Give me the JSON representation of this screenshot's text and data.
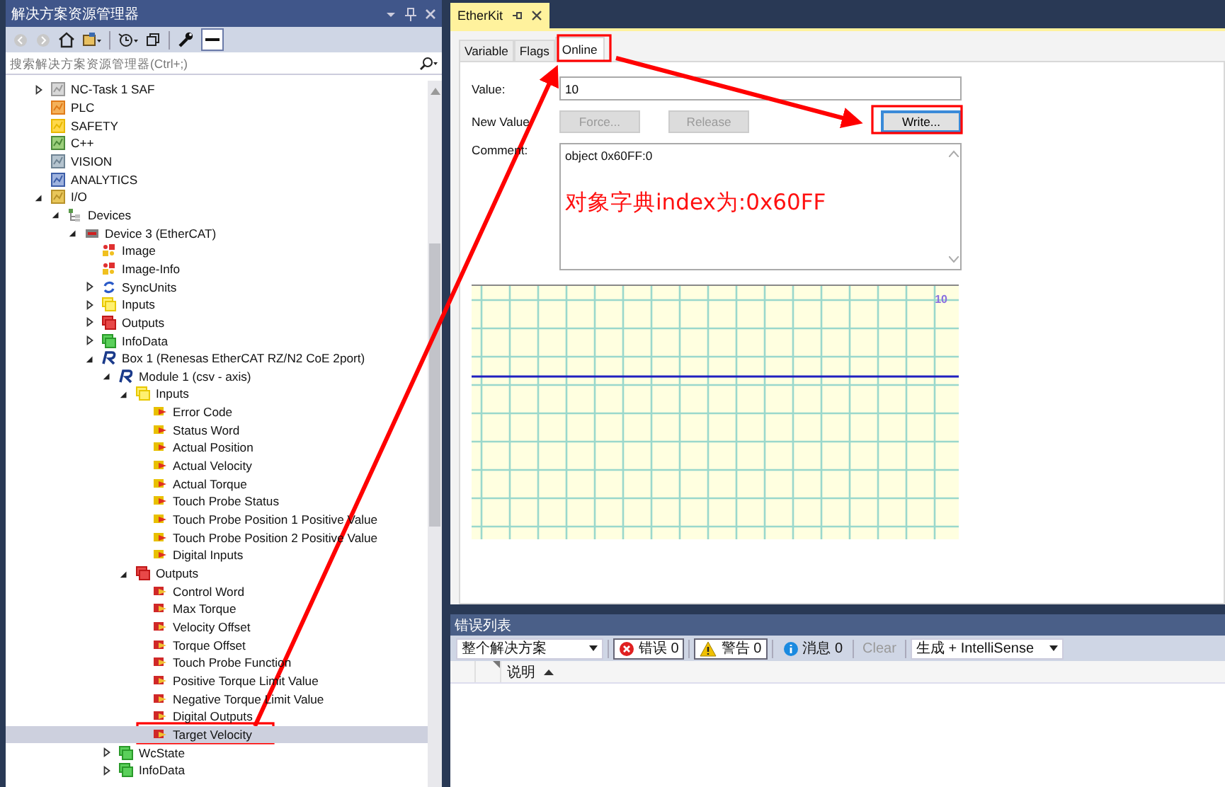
{
  "solution_explorer": {
    "title": "解决方案资源管理器",
    "search": {
      "placeholder": "搜索解决方案资源管理器(Ctrl+;)"
    },
    "tree": [
      {
        "label": "NC-Task 1 SAF",
        "kind": "task",
        "expanded": false,
        "selected": false
      },
      {
        "label": "PLC",
        "kind": "plc",
        "selected": false
      },
      {
        "label": "SAFETY",
        "kind": "safety",
        "selected": false
      },
      {
        "label": "C++",
        "kind": "cpp",
        "selected": false
      },
      {
        "label": "VISION",
        "kind": "vision",
        "selected": false
      },
      {
        "label": "ANALYTICS",
        "kind": "analytics",
        "selected": false
      },
      {
        "label": "I/O",
        "kind": "io",
        "expanded": true,
        "selected": false,
        "children": [
          {
            "label": "Devices",
            "kind": "devices",
            "expanded": true,
            "selected": false,
            "children": [
              {
                "label": "Device 3 (EtherCAT)",
                "kind": "device",
                "expanded": true,
                "selected": false,
                "children": [
                  {
                    "label": "Image",
                    "kind": "image",
                    "selected": false
                  },
                  {
                    "label": "Image-Info",
                    "kind": "image",
                    "selected": false
                  },
                  {
                    "label": "SyncUnits",
                    "kind": "sync",
                    "expanded": false,
                    "selected": false
                  },
                  {
                    "label": "Inputs",
                    "kind": "inputs",
                    "expanded": false,
                    "selected": false
                  },
                  {
                    "label": "Outputs",
                    "kind": "outputs",
                    "expanded": false,
                    "selected": false
                  },
                  {
                    "label": "InfoData",
                    "kind": "infodata",
                    "expanded": false,
                    "selected": false
                  },
                  {
                    "label": "Box 1 (Renesas EtherCAT RZ/N2 CoE 2port)",
                    "kind": "box",
                    "expanded": true,
                    "selected": false,
                    "children": [
                      {
                        "label": "Module 1 (csv - axis)",
                        "kind": "box",
                        "expanded": true,
                        "selected": false,
                        "children": [
                          {
                            "label": "Inputs",
                            "kind": "inputs",
                            "expanded": true,
                            "selected": false,
                            "children": [
                              {
                                "label": "Error Code",
                                "kind": "input-var",
                                "selected": false
                              },
                              {
                                "label": "Status Word",
                                "kind": "input-var",
                                "selected": false
                              },
                              {
                                "label": "Actual Position",
                                "kind": "input-var",
                                "selected": false
                              },
                              {
                                "label": "Actual Velocity",
                                "kind": "input-var",
                                "selected": false
                              },
                              {
                                "label": "Actual Torque",
                                "kind": "input-var",
                                "selected": false
                              },
                              {
                                "label": "Touch Probe Status",
                                "kind": "input-var",
                                "selected": false
                              },
                              {
                                "label": "Touch Probe Position 1 Positive Value",
                                "kind": "input-var",
                                "selected": false
                              },
                              {
                                "label": "Touch Probe Position 2 Positive Value",
                                "kind": "input-var",
                                "selected": false
                              },
                              {
                                "label": "Digital Inputs",
                                "kind": "input-var",
                                "selected": false
                              }
                            ]
                          },
                          {
                            "label": "Outputs",
                            "kind": "outputs",
                            "expanded": true,
                            "selected": false,
                            "children": [
                              {
                                "label": "Control Word",
                                "kind": "output-var",
                                "selected": false
                              },
                              {
                                "label": "Max Torque",
                                "kind": "output-var",
                                "selected": false
                              },
                              {
                                "label": "Velocity Offset",
                                "kind": "output-var",
                                "selected": false
                              },
                              {
                                "label": "Torque Offset",
                                "kind": "output-var",
                                "selected": false
                              },
                              {
                                "label": "Touch Probe Function",
                                "kind": "output-var",
                                "selected": false
                              },
                              {
                                "label": "Positive Torque Limit Value",
                                "kind": "output-var",
                                "selected": false
                              },
                              {
                                "label": "Negative Torque Limit Value",
                                "kind": "output-var",
                                "selected": false
                              },
                              {
                                "label": "Digital Outputs",
                                "kind": "output-var",
                                "selected": false
                              },
                              {
                                "label": "Target Velocity",
                                "kind": "output-var",
                                "selected": true
                              }
                            ]
                          }
                        ]
                      },
                      {
                        "label": "WcState",
                        "kind": "infodata",
                        "expanded": false,
                        "selected": false
                      },
                      {
                        "label": "InfoData",
                        "kind": "infodata",
                        "expanded": false,
                        "selected": false
                      }
                    ]
                  }
                ]
              }
            ]
          }
        ]
      }
    ]
  },
  "document_tab": {
    "title": "EtherKit"
  },
  "tabs": [
    {
      "label": "Variable",
      "selected": false
    },
    {
      "label": "Flags",
      "selected": false
    },
    {
      "label": "Online",
      "selected": true
    }
  ],
  "online": {
    "value_label": "Value:",
    "value": "10",
    "new_value_label": "New Value",
    "comment_label": "Comment:",
    "comment": "object 0x60FF:0",
    "annotation": "对象字典index为:0x60FF",
    "graph_label": "10",
    "buttons": [
      {
        "label": "Force...",
        "disabled": true
      },
      {
        "label": "Release",
        "disabled": true
      },
      {
        "label": "Write...",
        "disabled": false
      }
    ]
  },
  "error_list": {
    "title": "错误列表",
    "scope": "整个解决方案",
    "filters": [
      {
        "kind": "error",
        "label": "错误 0",
        "selected": true
      },
      {
        "kind": "warning",
        "label": "警告 0",
        "selected": true
      },
      {
        "kind": "message",
        "label": "消息 0",
        "selected": false
      }
    ],
    "clear": {
      "label": "Clear",
      "disabled": true
    },
    "source": "生成 + IntelliSense",
    "columns": [
      "说明"
    ]
  }
}
